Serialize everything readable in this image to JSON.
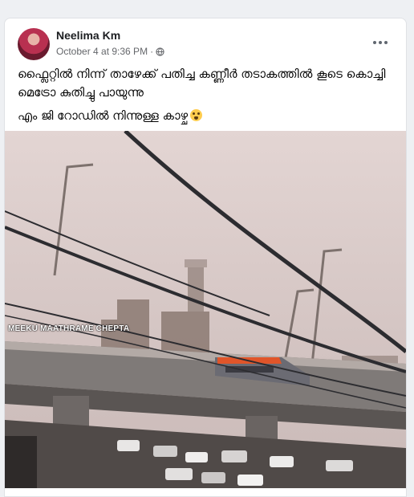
{
  "post": {
    "author": "Neelima Km",
    "timestamp": "October 4 at 9:36 PM",
    "separator": "·",
    "privacy_icon": "globe-icon",
    "more_icon": "more-options-icon",
    "caption_line1": "ഫ്ലൈറ്റിൽ നിന്ന് താഴേക്ക് പതിച്ച കണ്ണീർ തടാകത്തിൽ കൂടെ കൊച്ചി മെട്രോ കുതിച്ചു പായുന്നു",
    "caption_line2": "എം ജി റോഡിൽ നിന്നുള്ള കാഴ്ച",
    "caption_emoji": "crying-face-emoji"
  },
  "media": {
    "watermark": "MEEKU MAATHRAME CHEPTA"
  },
  "colors": {
    "sky": "#d9c9c8",
    "metro_accent": "#e0552a",
    "text_primary": "#050505",
    "text_secondary": "#65676b"
  }
}
